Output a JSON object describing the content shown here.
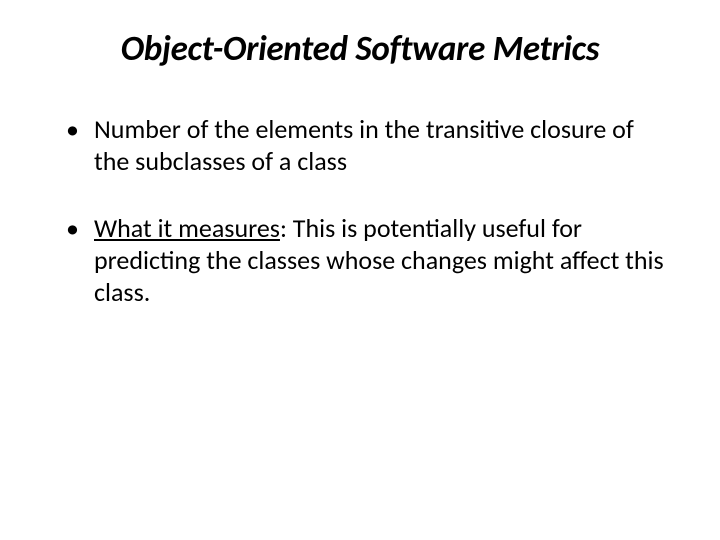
{
  "title": "Object-Oriented Software Metrics",
  "bullets": [
    {
      "prefix": "",
      "text": "Number of the elements in the transitive closure of the subclasses of a class"
    },
    {
      "prefix": "What it measures",
      "text": ": This is potentially useful for predicting the classes whose changes might affect this class."
    }
  ]
}
